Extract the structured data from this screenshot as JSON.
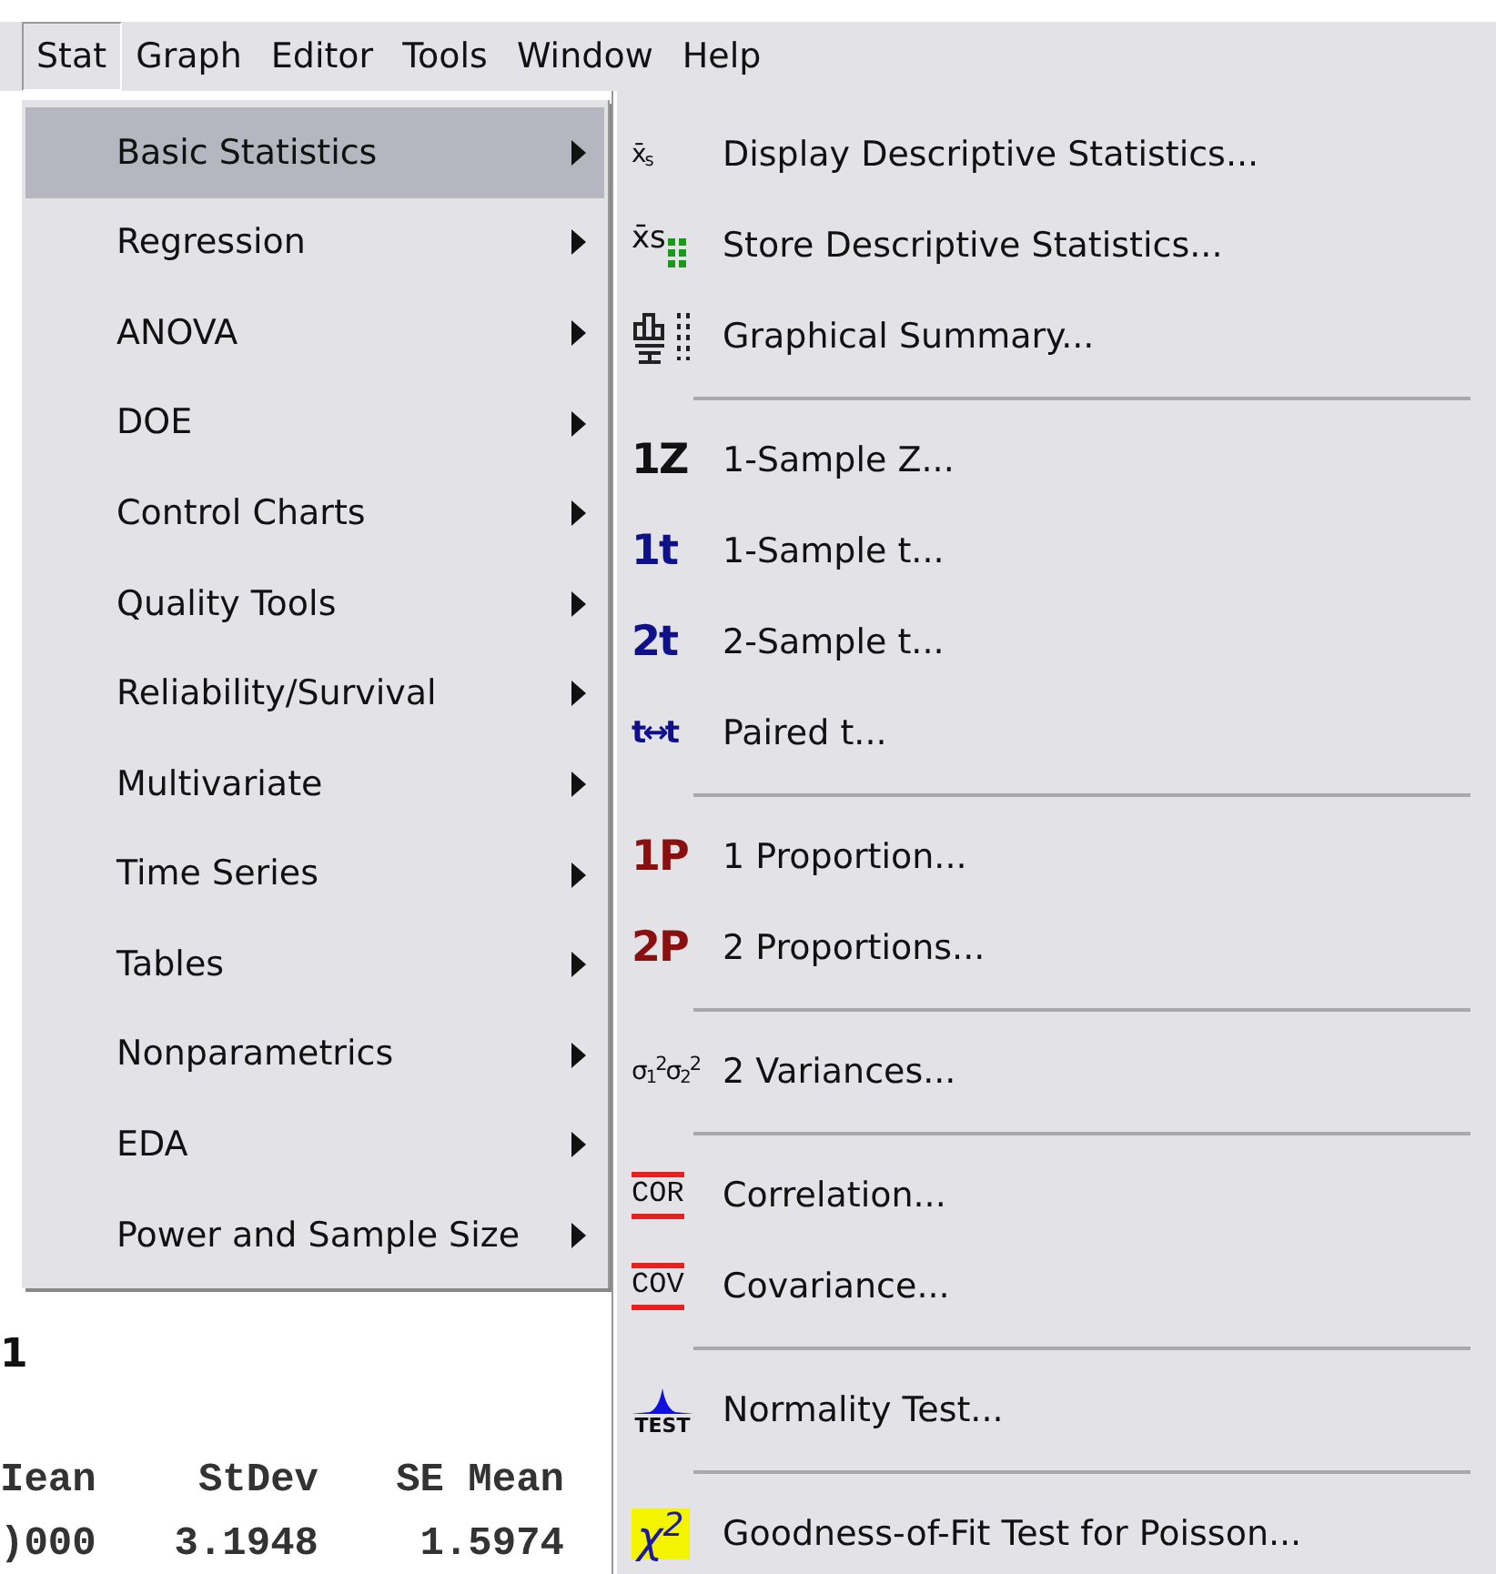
{
  "menubar": [
    {
      "label": "Stat",
      "selected": true
    },
    {
      "label": "Graph",
      "selected": false
    },
    {
      "label": "Editor",
      "selected": false
    },
    {
      "label": "Tools",
      "selected": false
    },
    {
      "label": "Window",
      "selected": false
    },
    {
      "label": "Help",
      "selected": false
    }
  ],
  "stat_menu": [
    {
      "label": "Basic Statistics",
      "selected": true,
      "submenu": true
    },
    {
      "label": "Regression",
      "selected": false,
      "submenu": true
    },
    {
      "label": "ANOVA",
      "selected": false,
      "submenu": true
    },
    {
      "label": "DOE",
      "selected": false,
      "submenu": true
    },
    {
      "label": "Control Charts",
      "selected": false,
      "submenu": true
    },
    {
      "label": "Quality Tools",
      "selected": false,
      "submenu": true
    },
    {
      "label": "Reliability/Survival",
      "selected": false,
      "submenu": true
    },
    {
      "label": "Multivariate",
      "selected": false,
      "submenu": true
    },
    {
      "label": "Time Series",
      "selected": false,
      "submenu": true
    },
    {
      "label": "Tables",
      "selected": false,
      "submenu": true
    },
    {
      "label": "Nonparametrics",
      "selected": false,
      "submenu": true
    },
    {
      "label": "EDA",
      "selected": false,
      "submenu": true
    },
    {
      "label": "Power and Sample Size",
      "selected": false,
      "submenu": true
    }
  ],
  "basic_statistics_menu": [
    {
      "kind": "item",
      "label": "Display Descriptive Statistics...",
      "icon": {
        "kind": "symbol",
        "text": "x̄$_{s}$"
      }
    },
    {
      "kind": "item",
      "label": "Store Descriptive Statistics...",
      "icon": {
        "kind": "store",
        "text": "x̄s"
      }
    },
    {
      "kind": "item",
      "label": "Graphical Summary...",
      "icon": {
        "kind": "summary"
      }
    },
    {
      "kind": "separator"
    },
    {
      "kind": "item",
      "label": "1-Sample Z...",
      "icon": {
        "kind": "glyph",
        "text": "1Z",
        "color": "#111111"
      }
    },
    {
      "kind": "item",
      "label": "1-Sample t...",
      "icon": {
        "kind": "glyph",
        "text": "1t",
        "color": "#10108a"
      }
    },
    {
      "kind": "item",
      "label": "2-Sample t...",
      "icon": {
        "kind": "glyph",
        "text": "2t",
        "color": "#10108a"
      }
    },
    {
      "kind": "item",
      "label": "Paired t...",
      "icon": {
        "kind": "glyph",
        "text": "t↔t",
        "color": "#10108a"
      }
    },
    {
      "kind": "separator"
    },
    {
      "kind": "item",
      "label": "1 Proportion...",
      "icon": {
        "kind": "glyph",
        "text": "1P",
        "color": "#8a1010"
      }
    },
    {
      "kind": "item",
      "label": "2 Proportions...",
      "icon": {
        "kind": "glyph",
        "text": "2P",
        "color": "#8a1010"
      }
    },
    {
      "kind": "separator"
    },
    {
      "kind": "item",
      "label": "2 Variances...",
      "icon": {
        "kind": "symbol",
        "text": "σ$_{1}$$^{2}$σ$_{2}$$^{2}$"
      }
    },
    {
      "kind": "separator"
    },
    {
      "kind": "item",
      "label": "Correlation...",
      "icon": {
        "kind": "bracket",
        "text": "COR"
      }
    },
    {
      "kind": "item",
      "label": "Covariance...",
      "icon": {
        "kind": "bracket",
        "text": "COV"
      }
    },
    {
      "kind": "separator"
    },
    {
      "kind": "item",
      "label": "Normality Test...",
      "icon": {
        "kind": "test",
        "text": "TEST"
      }
    },
    {
      "kind": "separator"
    },
    {
      "kind": "item",
      "label": "Goodness-of-Fit Test for Poisson...",
      "icon": {
        "kind": "chi",
        "text": "χ$^{2}$"
      }
    }
  ],
  "session": {
    "heading": "1",
    "columns": [
      "Iean",
      "StDev",
      "SE Mean"
    ],
    "values": [
      ")000",
      "3.1948",
      "1.5974"
    ]
  }
}
